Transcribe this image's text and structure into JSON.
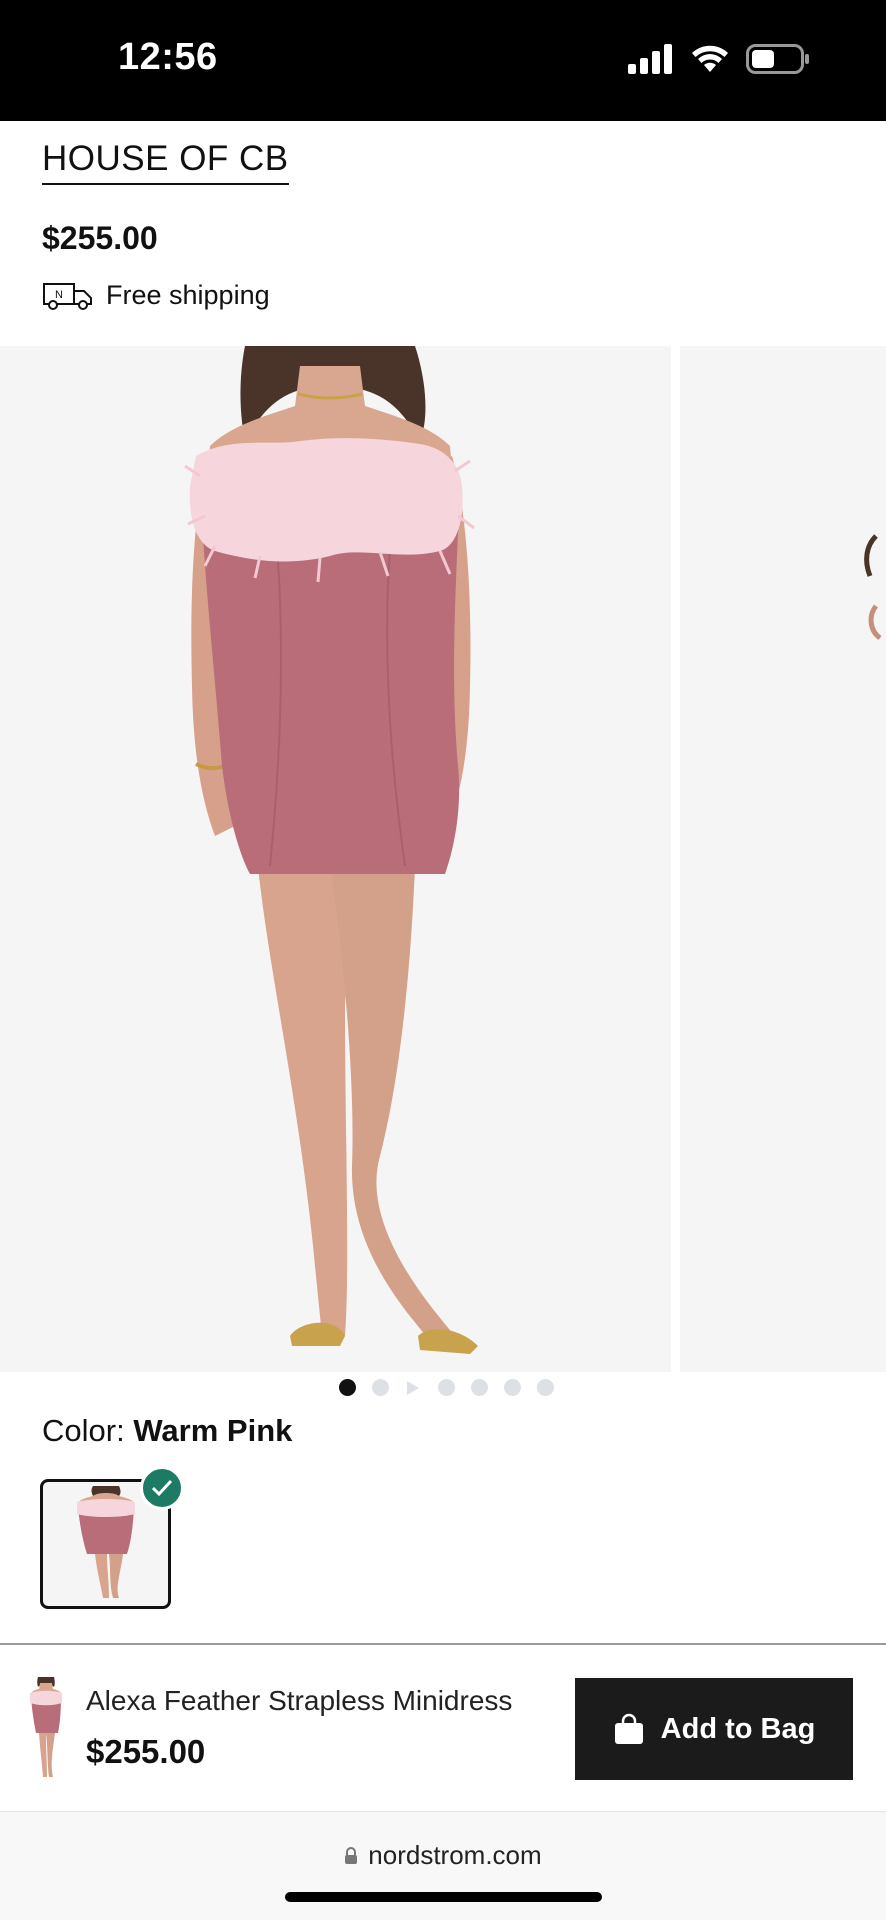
{
  "status": {
    "time": "12:56"
  },
  "product": {
    "brand": "HOUSE OF CB",
    "price": "$255.00",
    "shipping": "Free shipping",
    "name": "Alexa Feather Strapless Minidress"
  },
  "gallery": {
    "image_count": 7,
    "active_index": 0
  },
  "color": {
    "label": "Color:",
    "value": "Warm Pink"
  },
  "sticky": {
    "name": "Alexa Feather Strapless Minidress",
    "price": "$255.00",
    "add_to_bag": "Add to Bag"
  },
  "browser": {
    "url": "nordstrom.com"
  },
  "colors": {
    "dress": "#b86d79",
    "feather": "#f6d5dc",
    "check": "#1c7a65",
    "button": "#1b1b1b"
  }
}
